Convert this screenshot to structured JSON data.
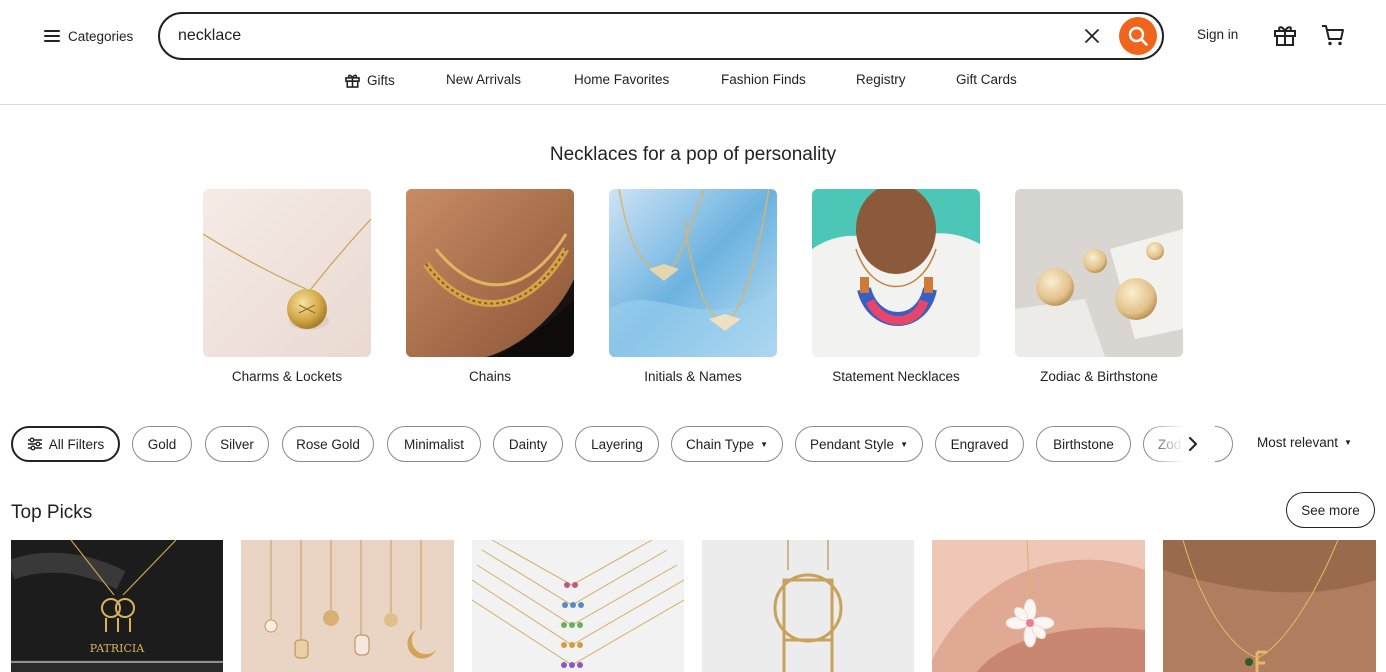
{
  "header": {
    "categories_label": "Categories",
    "search_value": "necklace",
    "sign_in_label": "Sign in",
    "accent_color": "#f1641e"
  },
  "nav": {
    "items": [
      {
        "label": "Gifts",
        "icon": "gift-icon"
      },
      {
        "label": "New Arrivals"
      },
      {
        "label": "Home Favorites"
      },
      {
        "label": "Fashion Finds"
      },
      {
        "label": "Registry"
      },
      {
        "label": "Gift Cards"
      }
    ]
  },
  "hero": {
    "title": "Necklaces for a pop of personality",
    "categories": [
      {
        "label": "Charms & Lockets"
      },
      {
        "label": "Chains"
      },
      {
        "label": "Initials & Names"
      },
      {
        "label": "Statement Necklaces"
      },
      {
        "label": "Zodiac & Birthstone"
      }
    ]
  },
  "filters": {
    "all_filters_label": "All Filters",
    "chips": [
      {
        "label": "Gold"
      },
      {
        "label": "Silver"
      },
      {
        "label": "Rose Gold"
      },
      {
        "label": "Minimalist"
      },
      {
        "label": "Dainty"
      },
      {
        "label": "Layering"
      },
      {
        "label": "Chain Type"
      },
      {
        "label": "Pendant Style"
      },
      {
        "label": "Engraved"
      },
      {
        "label": "Birthstone"
      },
      {
        "label": "Zod"
      }
    ],
    "sort_label": "Most relevant"
  },
  "top_picks": {
    "title": "Top Picks",
    "see_more_label": "See more",
    "image_text": "PATRICIA"
  }
}
